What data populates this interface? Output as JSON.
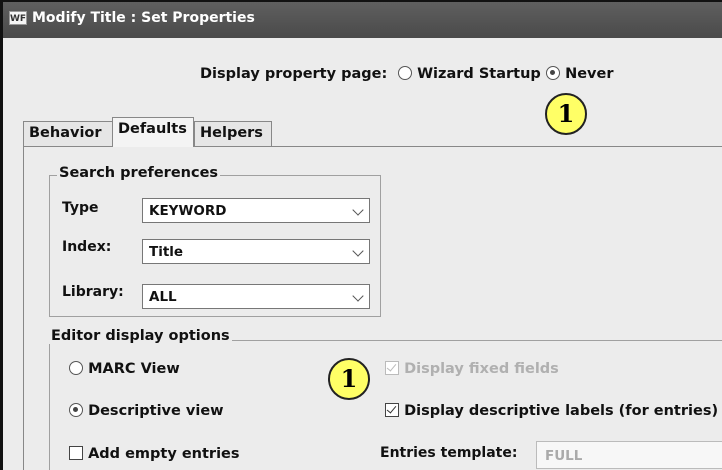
{
  "window": {
    "icon_label": "WF",
    "title": "Modify Title : Set Properties"
  },
  "property_page": {
    "label": "Display property page:",
    "options": [
      "Wizard Startup",
      "Never"
    ],
    "selected": "Never"
  },
  "callouts": [
    "1",
    "1"
  ],
  "tabs": [
    "Behavior",
    "Defaults",
    "Helpers"
  ],
  "active_tab": "Defaults",
  "search_preferences": {
    "legend": "Search preferences",
    "type_label": "Type",
    "type_value": "KEYWORD",
    "index_label": "Index:",
    "index_value": "Title",
    "library_label": "Library:",
    "library_value": "ALL"
  },
  "editor_display": {
    "legend": "Editor display options",
    "marc_view": "MARC View",
    "descriptive_view": "Descriptive view",
    "selected_view": "Descriptive view",
    "add_empty_entries": "Add empty entries",
    "display_fixed_fields": "Display fixed fields",
    "display_descriptive_labels": "Display descriptive labels (for entries)",
    "entries_template_label": "Entries template:",
    "entries_template_value": "FULL"
  },
  "colors": {
    "titlebar": "#4f4f4f",
    "callout_fill": "#ffff66",
    "disabled_text": "#b0b0b0"
  }
}
